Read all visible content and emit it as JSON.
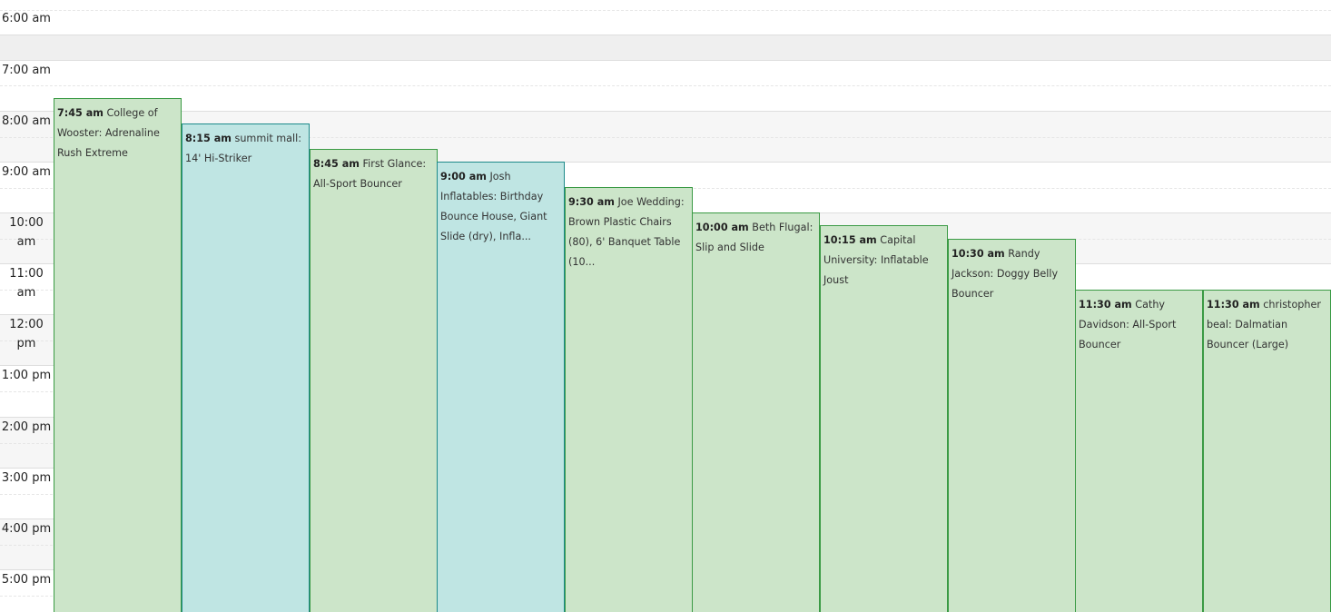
{
  "time_slots": [
    {
      "label": "6:00 am",
      "shaded": false
    },
    {
      "label": "",
      "shaded": true
    },
    {
      "label": "7:00 am",
      "shaded": false
    },
    {
      "label": "8:00 am",
      "shaded": false
    },
    {
      "label": "9:00 am",
      "shaded": false
    },
    {
      "label": "10:00 am",
      "shaded": false
    },
    {
      "label": "11:00 am",
      "shaded": false
    },
    {
      "label": "12:00 pm",
      "shaded": false
    },
    {
      "label": "1:00 pm",
      "shaded": false
    },
    {
      "label": "2:00 pm",
      "shaded": false
    },
    {
      "label": "3:00 pm",
      "shaded": false
    },
    {
      "label": "4:00 pm",
      "shaded": false
    },
    {
      "label": "5:00 pm",
      "shaded": false
    }
  ],
  "events": [
    {
      "time": "7:45 am",
      "title": "College of Wooster: Adrenaline Rush Extreme",
      "color": "green"
    },
    {
      "time": "8:15 am",
      "title": "summit mall: 14' Hi-Striker",
      "color": "teal"
    },
    {
      "time": "8:45 am",
      "title": "First Glance: All-Sport Bouncer",
      "color": "green"
    },
    {
      "time": "9:00 am",
      "title": "Josh Inflatables: Birthday Bounce House, Giant Slide (dry), Infla...",
      "color": "teal"
    },
    {
      "time": "9:30 am",
      "title": "Joe Wedding: Brown Plastic Chairs (80), 6' Banquet Table (10...",
      "color": "green"
    },
    {
      "time": "10:00 am",
      "title": "Beth Flugal: Slip and Slide",
      "color": "green"
    },
    {
      "time": "10:15 am",
      "title": "Capital University: Inflatable Joust",
      "color": "green"
    },
    {
      "time": "10:30 am",
      "title": "Randy Jackson: Doggy Belly Bouncer",
      "color": "green"
    },
    {
      "time": "11:30 am",
      "title": "Cathy Davidson: All-Sport Bouncer",
      "color": "green"
    },
    {
      "time": "11:30 am",
      "title": "christopher beal: Dalmatian Bouncer (Large)",
      "color": "green"
    }
  ]
}
